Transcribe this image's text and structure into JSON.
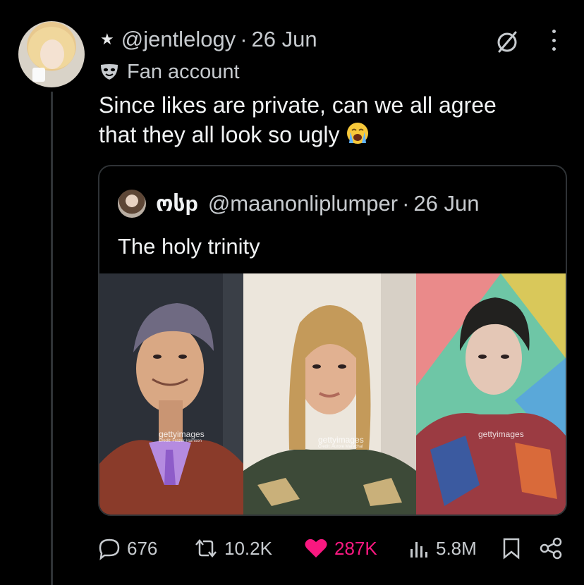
{
  "tweet": {
    "star": "★",
    "handle": "@jentlelogy",
    "separator": "·",
    "date": "26 Jun",
    "label": "Fan account",
    "text_line1": "Since likes are private, can we all agree",
    "text_line2": "that they all look so ugly",
    "emoji": "loudly-crying-face-emoji"
  },
  "quote": {
    "display_name": "ოსp",
    "handle": "@maanonliplumper",
    "separator": "·",
    "date": "26 Jun",
    "text": "The holy trinity",
    "photos": [
      {
        "watermark": "gettyimages",
        "credit": "Credit: Frazer Harrison"
      },
      {
        "watermark": "gettyimages",
        "credit": "Credit: Aurore Marechal"
      },
      {
        "watermark": "gettyimages",
        "credit": ""
      }
    ]
  },
  "actions": {
    "replies": "676",
    "reposts": "10.2K",
    "likes": "287K",
    "views": "5.8M"
  },
  "colors": {
    "background": "#000000",
    "text": "#e7e9ea",
    "secondary_text": "#c7cbcf",
    "border": "#2f3336",
    "like": "#f91880"
  }
}
